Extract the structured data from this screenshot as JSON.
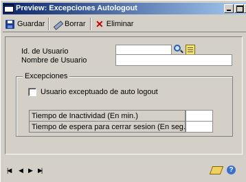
{
  "window": {
    "title": "Preview: Excepciones Autologout"
  },
  "toolbar": {
    "save_label": "Guardar",
    "clear_label": "Borrar",
    "delete_label": "Eliminar"
  },
  "form": {
    "user_id_label": "Id. de Usuario",
    "user_id_value": "",
    "user_name_label": "Nombre de Usuario",
    "user_name_value": ""
  },
  "exceptions": {
    "group_label": "Excepciones",
    "checkbox_label": "Usuario exceptuado de auto logout",
    "checked": false,
    "inactivity_label": "Tiempo de Inactividad (En min.)",
    "inactivity_value": "",
    "wait_label": "Tiempo de espera para cerrar sesion (En seg.)",
    "wait_value": ""
  },
  "icons": {
    "save": "save-icon",
    "clear": "eraser-icon",
    "delete": "delete-x-icon",
    "lookup": "magnifier-icon",
    "note": "note-icon",
    "nav_first": "first-record-icon",
    "nav_prev": "previous-record-icon",
    "nav_next": "next-record-icon",
    "nav_last": "last-record-icon",
    "edit": "pencil-icon",
    "help": "help-icon"
  },
  "colors": {
    "titlebar_start": "#0a246a",
    "titlebar_end": "#a6caf0",
    "window_bg": "#d4d0c8",
    "delete_red": "#c00000"
  }
}
